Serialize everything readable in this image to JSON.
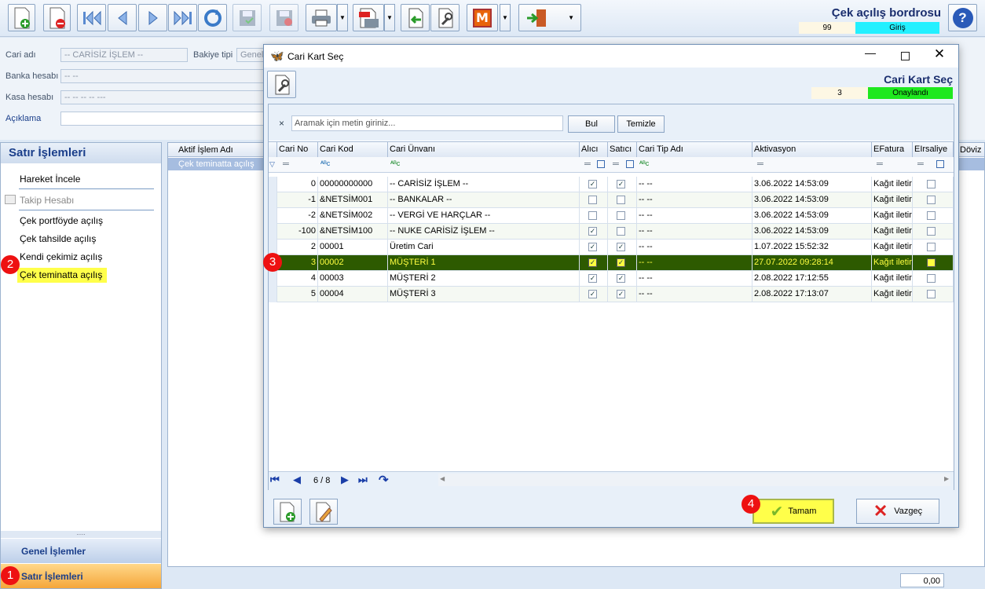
{
  "header": {
    "title": "Çek açılış bordrosu",
    "number": "99",
    "status": "Giriş"
  },
  "form": {
    "cari_label": "Cari adı",
    "cari_value": "-- CARİSİZ İŞLEM --",
    "bakiye_label": "Bakiye tipi",
    "bakiye_value": "Genel B",
    "banka_label": "Banka hesabı",
    "banka_value": "-- --",
    "kasa_label": "Kasa hesabı",
    "kasa_value": "-- -- -- -- ---",
    "aciklama_label": "Açıklama"
  },
  "sidebar": {
    "title": "Satır İşlemleri",
    "items": [
      "Hareket İncele",
      "Takip Hesabı",
      "Çek portföyde açılış",
      "Çek tahsilde açılış",
      "Kendi çekimiz açılış",
      "Çek teminatta açılış"
    ],
    "grip": ".....",
    "bottom": {
      "general": "Genel İşlemler",
      "line": "Satır İşlemleri"
    }
  },
  "main_grid": {
    "col1": "Aktif İşlem Adı",
    "col_right": "Döviz",
    "row1": "Çek teminatta açılış",
    "total": "0,00"
  },
  "dialog": {
    "title": "Cari Kart Seç",
    "heading": "Cari Kart Seç",
    "count": "3",
    "status": "Onaylandı",
    "search": {
      "clear": "×",
      "placeholder": "Aramak için metin giriniz...",
      "find": "Bul",
      "reset": "Temizle"
    },
    "columns": [
      "Cari No",
      "Cari Kod",
      "Cari Ünvanı",
      "Alıcı",
      "Satıcı",
      "Cari Tip Adı",
      "Aktivasyon",
      "EFatura",
      "EIrsaliye"
    ],
    "filter_eq": "═",
    "filter_text_icon": "ᴬᴮc",
    "rows": [
      {
        "no": "0",
        "kod": "00000000000",
        "unvan": "-- CARİSİZ İŞLEM --",
        "alici": true,
        "satici": true,
        "tip": "-- --",
        "akt": "3.06.2022 14:53:09",
        "efat": "Kağıt iletin",
        "eirs": false,
        "sel": false
      },
      {
        "no": "-1",
        "kod": "&NETSİM001",
        "unvan": "-- BANKALAR --",
        "alici": false,
        "satici": false,
        "tip": "-- --",
        "akt": "3.06.2022 14:53:09",
        "efat": "Kağıt iletin",
        "eirs": false,
        "sel": false
      },
      {
        "no": "-2",
        "kod": "&NETSİM002",
        "unvan": "-- VERGİ VE HARÇLAR --",
        "alici": false,
        "satici": false,
        "tip": "-- --",
        "akt": "3.06.2022 14:53:09",
        "efat": "Kağıt iletin",
        "eirs": false,
        "sel": false
      },
      {
        "no": "-100",
        "kod": "&NETSİM100",
        "unvan": "-- NUKE CARİSİZ İŞLEM --",
        "alici": true,
        "satici": false,
        "tip": "-- --",
        "akt": "3.06.2022 14:53:09",
        "efat": "Kağıt iletin",
        "eirs": false,
        "sel": false
      },
      {
        "no": "2",
        "kod": "00001",
        "unvan": "Üretim Cari",
        "alici": true,
        "satici": true,
        "tip": "-- --",
        "akt": "1.07.2022 15:52:32",
        "efat": "Kağıt iletin",
        "eirs": false,
        "sel": false
      },
      {
        "no": "3",
        "kod": "00002",
        "unvan": "MÜŞTERİ 1",
        "alici": true,
        "satici": true,
        "tip": "-- --",
        "akt": "27.07.2022 09:28:14",
        "efat": "Kağıt iletin",
        "eirs": false,
        "sel": true
      },
      {
        "no": "4",
        "kod": "00003",
        "unvan": "MÜŞTERİ 2",
        "alici": true,
        "satici": true,
        "tip": "-- --",
        "akt": "2.08.2022 17:12:55",
        "efat": "Kağıt iletin",
        "eirs": false,
        "sel": false
      },
      {
        "no": "5",
        "kod": "00004",
        "unvan": "MÜŞTERİ 3",
        "alici": true,
        "satici": true,
        "tip": "-- --",
        "akt": "2.08.2022 17:13:07",
        "efat": "Kağıt iletin",
        "eirs": false,
        "sel": false
      }
    ],
    "pager": "6 / 8",
    "ok": "Tamam",
    "cancel": "Vazgeç"
  },
  "badges": [
    "1",
    "2",
    "3",
    "4"
  ],
  "colors": {
    "selected_row": "#2d5a00",
    "selected_text": "#ffff40",
    "highlight": "#ffff4a",
    "status_cyan": "#23f0ff",
    "status_green": "#1ee81e",
    "title_blue": "#1a2e6e"
  }
}
